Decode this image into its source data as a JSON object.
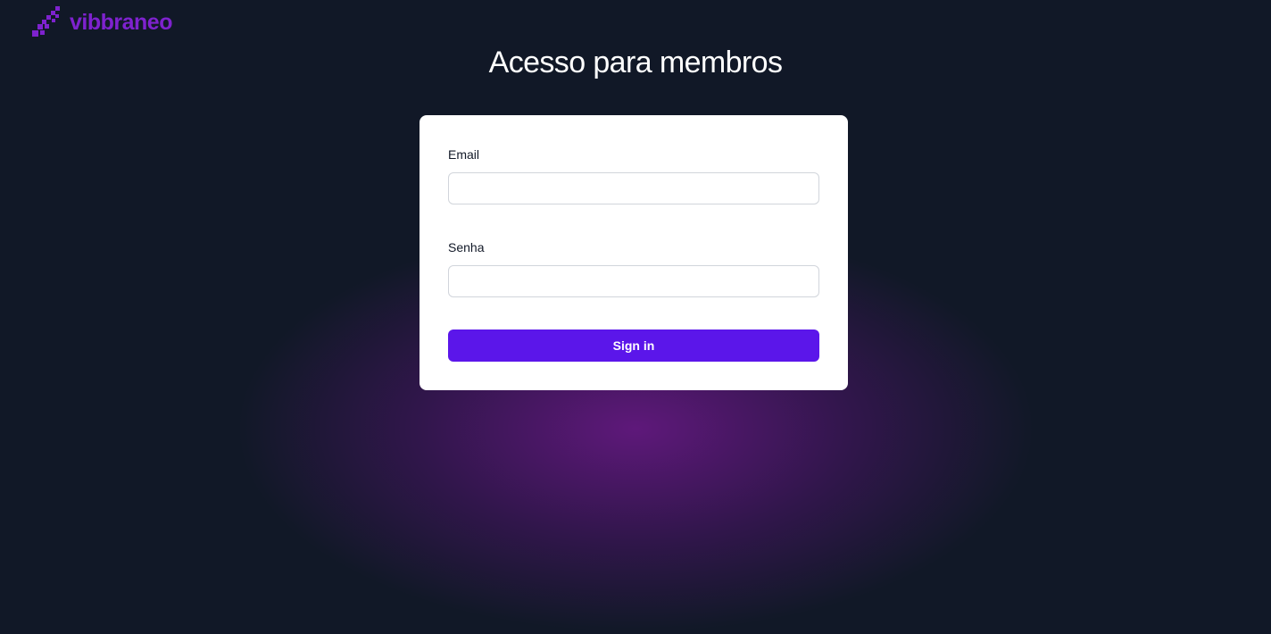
{
  "brand": {
    "name": "vibbraneo",
    "logo_icon": "pixel-arrow-logo-icon",
    "color": "#7e22ce"
  },
  "page": {
    "title": "Acesso para membros",
    "background_color": "#111827",
    "glow_color": "#7c1896"
  },
  "form": {
    "email_label": "Email",
    "email_value": "",
    "password_label": "Senha",
    "password_value": "",
    "submit_label": "Sign in",
    "submit_color": "#5b16ea"
  }
}
